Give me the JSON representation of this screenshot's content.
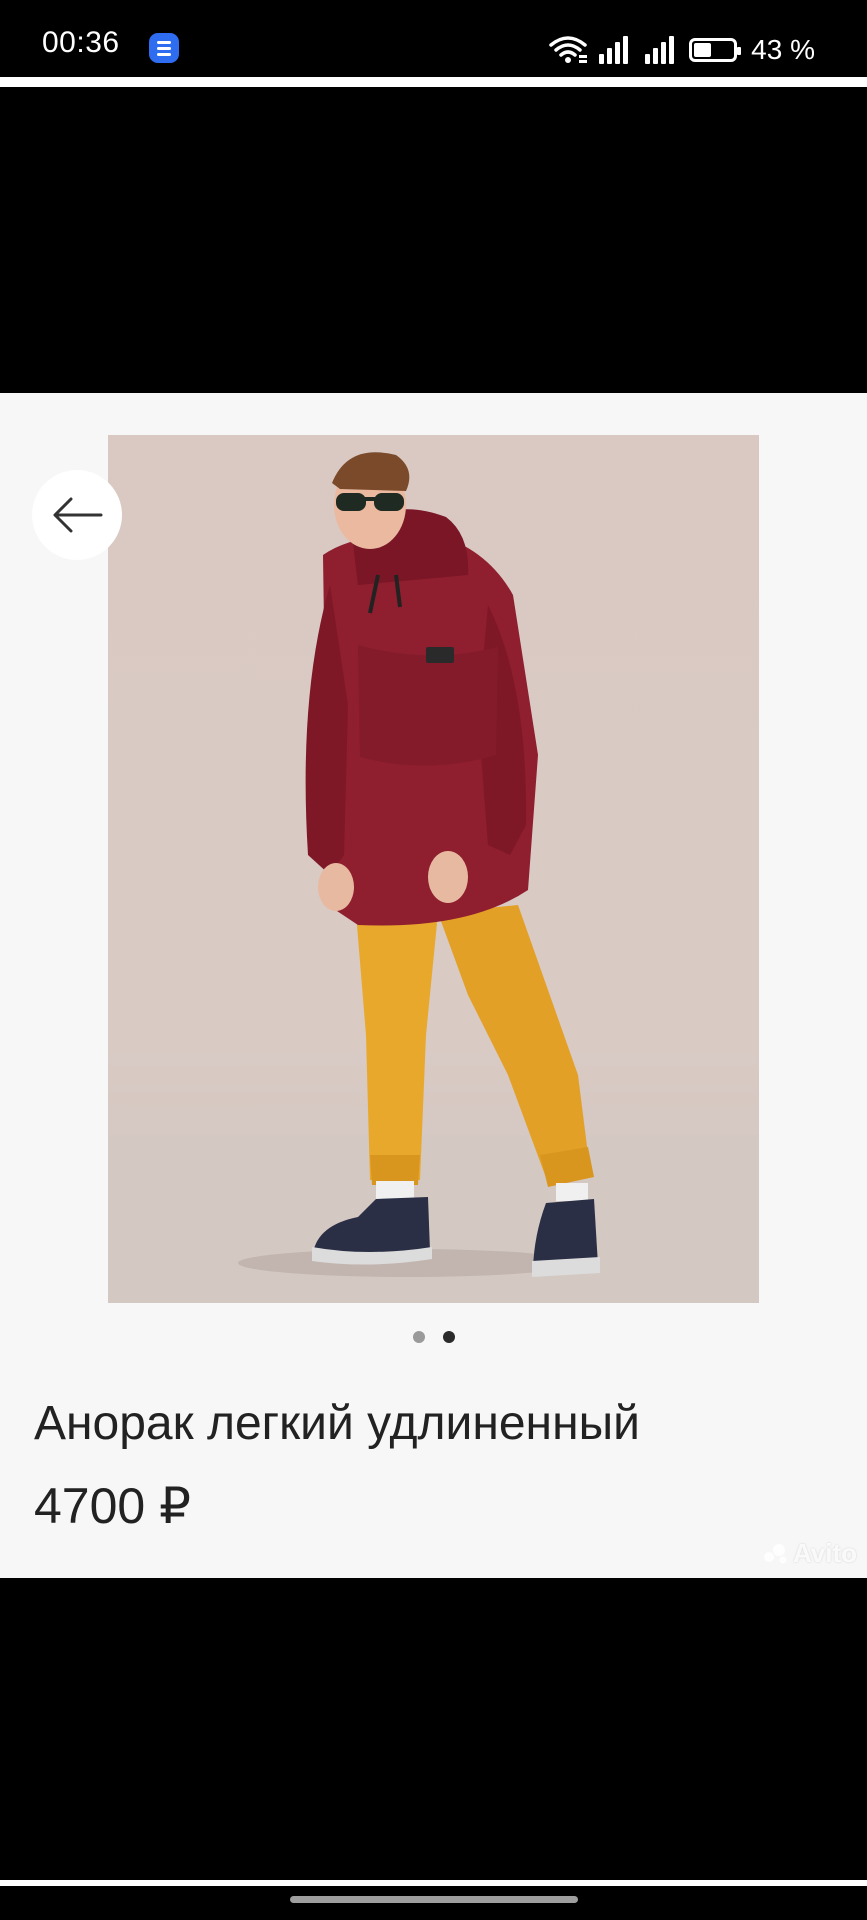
{
  "status_bar": {
    "time": "00:36",
    "battery_percent_label": "43 %",
    "battery_level": 0.43,
    "icons": [
      "app-notification-icon",
      "wifi-icon",
      "signal-icon",
      "signal-icon",
      "battery-icon"
    ]
  },
  "listing": {
    "back_icon": "arrow-left-icon",
    "title": "Анорак легкий удлиненный",
    "price": "4700 ₽",
    "carousel": {
      "total": 2,
      "active_index": 1
    },
    "watermark": "Avito",
    "colors": {
      "anorak": "#8f1e2e",
      "pants": "#e8a82c",
      "background": "#dac9c3"
    }
  }
}
